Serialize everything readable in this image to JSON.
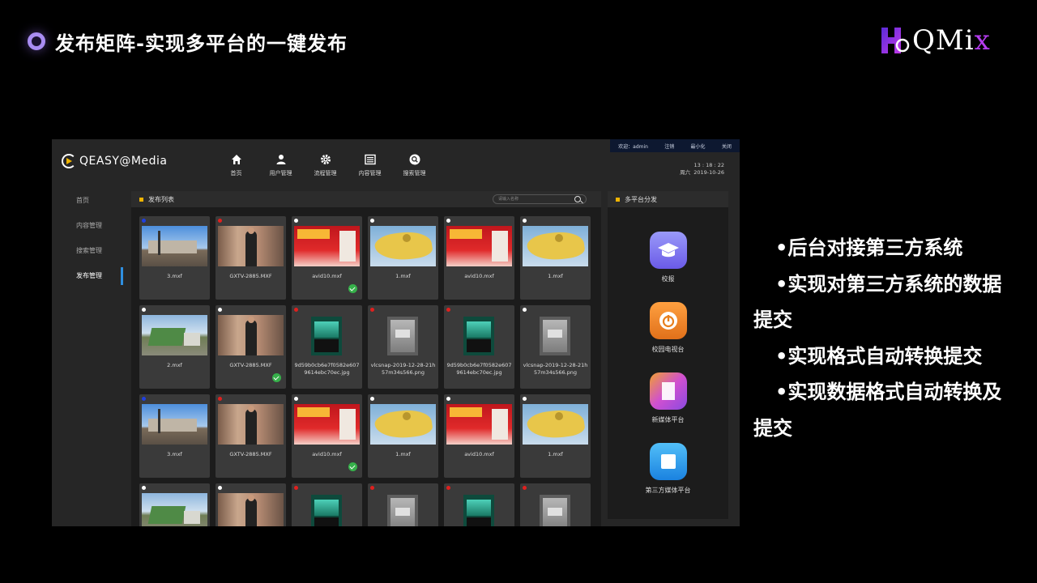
{
  "slide": {
    "title": "发布矩阵-实现多平台的一键发布",
    "logo_text": "QMi",
    "logo_accent": "x",
    "bullets": [
      "•后台对接第三方系统",
      "•实现对第三方系统的数据提交",
      "•实现格式自动转换提交",
      "•实现数据格式自动转换及提交"
    ]
  },
  "app": {
    "topbar": {
      "welcome": "欢迎：admin",
      "logout": "注销",
      "minimize": "最小化",
      "close": "关闭"
    },
    "brand": "QEASY@Media",
    "nav": [
      {
        "label": "首页",
        "icon": "home-icon"
      },
      {
        "label": "用户管理",
        "icon": "user-icon"
      },
      {
        "label": "流程管理",
        "icon": "gear-icon"
      },
      {
        "label": "内容管理",
        "icon": "list-icon"
      },
      {
        "label": "搜索管理",
        "icon": "search-icon"
      }
    ],
    "clock": {
      "time": "13 : 18 : 22",
      "weekday": "周六",
      "date": "2019-10-26"
    },
    "sidebar": [
      {
        "label": "首页",
        "active": false
      },
      {
        "label": "内容管理",
        "active": false
      },
      {
        "label": "搜索管理",
        "active": false
      },
      {
        "label": "发布管理",
        "active": true
      }
    ],
    "publish_list": {
      "title": "发布列表",
      "search_placeholder": "请输入名称",
      "items": [
        {
          "name": "3.mxf",
          "status": "blue",
          "thumb": "sky",
          "done": false
        },
        {
          "name": "GXTV-2885.MXF",
          "status": "red",
          "thumb": "street",
          "done": false
        },
        {
          "name": "avid10.mxf",
          "status": "white",
          "thumb": "red",
          "done": true
        },
        {
          "name": "1.mxf",
          "status": "white",
          "thumb": "map",
          "done": false
        },
        {
          "name": "avid10.mxf",
          "status": "white",
          "thumb": "red",
          "done": false
        },
        {
          "name": "1.mxf",
          "status": "white",
          "thumb": "map",
          "done": false
        },
        {
          "name": "2.mxf",
          "status": "white",
          "thumb": "truck",
          "done": false
        },
        {
          "name": "GXTV-2885.MXF",
          "status": "white",
          "thumb": "street",
          "done": true
        },
        {
          "name": "9d59b0cb6e7f0582e6079614ebc70ec.jpg",
          "status": "red",
          "thumb": "poster",
          "done": false
        },
        {
          "name": "vlcsnap-2019-12-28-21h57m34s566.png",
          "status": "red",
          "thumb": "snap",
          "done": false
        },
        {
          "name": "9d59b0cb6e7f0582e6079614ebc70ec.jpg",
          "status": "red",
          "thumb": "poster",
          "done": false
        },
        {
          "name": "vlcsnap-2019-12-28-21h57m34s566.png",
          "status": "white",
          "thumb": "snap",
          "done": false
        },
        {
          "name": "3.mxf",
          "status": "blue",
          "thumb": "sky",
          "done": false
        },
        {
          "name": "GXTV-2885.MXF",
          "status": "red",
          "thumb": "street",
          "done": false
        },
        {
          "name": "avid10.mxf",
          "status": "white",
          "thumb": "red",
          "done": true
        },
        {
          "name": "1.mxf",
          "status": "white",
          "thumb": "map",
          "done": false
        },
        {
          "name": "avid10.mxf",
          "status": "white",
          "thumb": "red",
          "done": false
        },
        {
          "name": "1.mxf",
          "status": "white",
          "thumb": "map",
          "done": false
        },
        {
          "name": "",
          "status": "white",
          "thumb": "truck",
          "done": false
        },
        {
          "name": "",
          "status": "white",
          "thumb": "street",
          "done": false
        },
        {
          "name": "",
          "status": "red",
          "thumb": "poster",
          "done": false
        },
        {
          "name": "",
          "status": "red",
          "thumb": "snap",
          "done": false
        },
        {
          "name": "",
          "status": "red",
          "thumb": "poster",
          "done": false
        },
        {
          "name": "",
          "status": "red",
          "thumb": "snap",
          "done": false
        }
      ]
    },
    "platforms": {
      "title": "多平台分发",
      "items": [
        {
          "label": "校报",
          "icon": "graduation-cap-icon",
          "color": "#7a7af0"
        },
        {
          "label": "校园电视台",
          "icon": "power-icon",
          "color": "#f08a2a"
        },
        {
          "label": "新媒体平台",
          "icon": "document-icon",
          "color": "#c85ad8"
        },
        {
          "label": "第三方媒体平台",
          "icon": "square-icon",
          "color": "#2a9ef0"
        }
      ]
    }
  },
  "colors": {
    "accent": "#f0b400",
    "active_bar": "#2f8fe0",
    "done": "#36b04a",
    "status_red": "#e0201e",
    "status_blue": "#2040e0"
  }
}
